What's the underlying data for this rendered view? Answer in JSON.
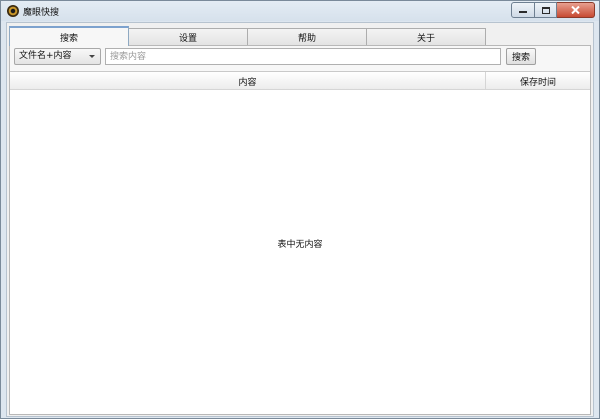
{
  "window": {
    "title": "魔眼快搜"
  },
  "tabs": [
    {
      "label": "搜索",
      "active": true
    },
    {
      "label": "设置",
      "active": false
    },
    {
      "label": "帮助",
      "active": false
    },
    {
      "label": "关于",
      "active": false
    }
  ],
  "search": {
    "scope_value": "文件名+内容",
    "placeholder": "搜索内容",
    "value": "",
    "button_label": "搜索"
  },
  "table": {
    "columns": [
      "内容",
      "保存时间"
    ],
    "empty_message": "表中无内容"
  },
  "colors": {
    "close_button": "#c74a32",
    "active_tab_accent": "#7da2ce"
  }
}
